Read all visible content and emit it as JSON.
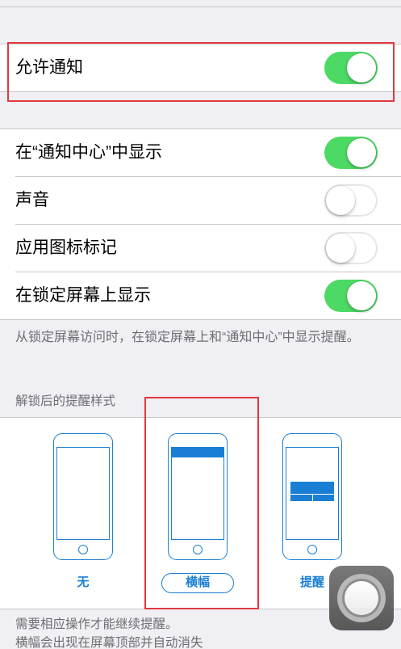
{
  "colors": {
    "background": "#efeff4",
    "cell": "#ffffff",
    "separator": "#c8c7cc",
    "toggle_on": "#4cd964",
    "accent": "#1a7fd4",
    "secondary_text": "#6d6d72",
    "highlight": "#e0393e"
  },
  "allow": {
    "label": "允许通知",
    "on": true
  },
  "options": [
    {
      "label": "在“通知中心”中显示",
      "on": true
    },
    {
      "label": "声音",
      "on": false
    },
    {
      "label": "应用图标标记",
      "on": false
    },
    {
      "label": "在锁定屏幕上显示",
      "on": true
    }
  ],
  "options_footer": "从锁定屏幕访问时，在锁定屏幕上和“通知中心”中显示提醒。",
  "alert_style": {
    "header": "解锁后的提醒样式",
    "choices": [
      {
        "label": "无",
        "icon": "phone-no-alert-icon",
        "selected": false
      },
      {
        "label": "横幅",
        "icon": "phone-banner-icon",
        "selected": true
      },
      {
        "label": "提醒",
        "icon": "phone-alert-icon",
        "selected": false
      }
    ],
    "footer": [
      "需要相应操作才能继续提醒。",
      "横幅会出现在屏幕顶部并自动消失"
    ]
  },
  "assistive_touch": {
    "icon": "assistive-touch-icon"
  }
}
